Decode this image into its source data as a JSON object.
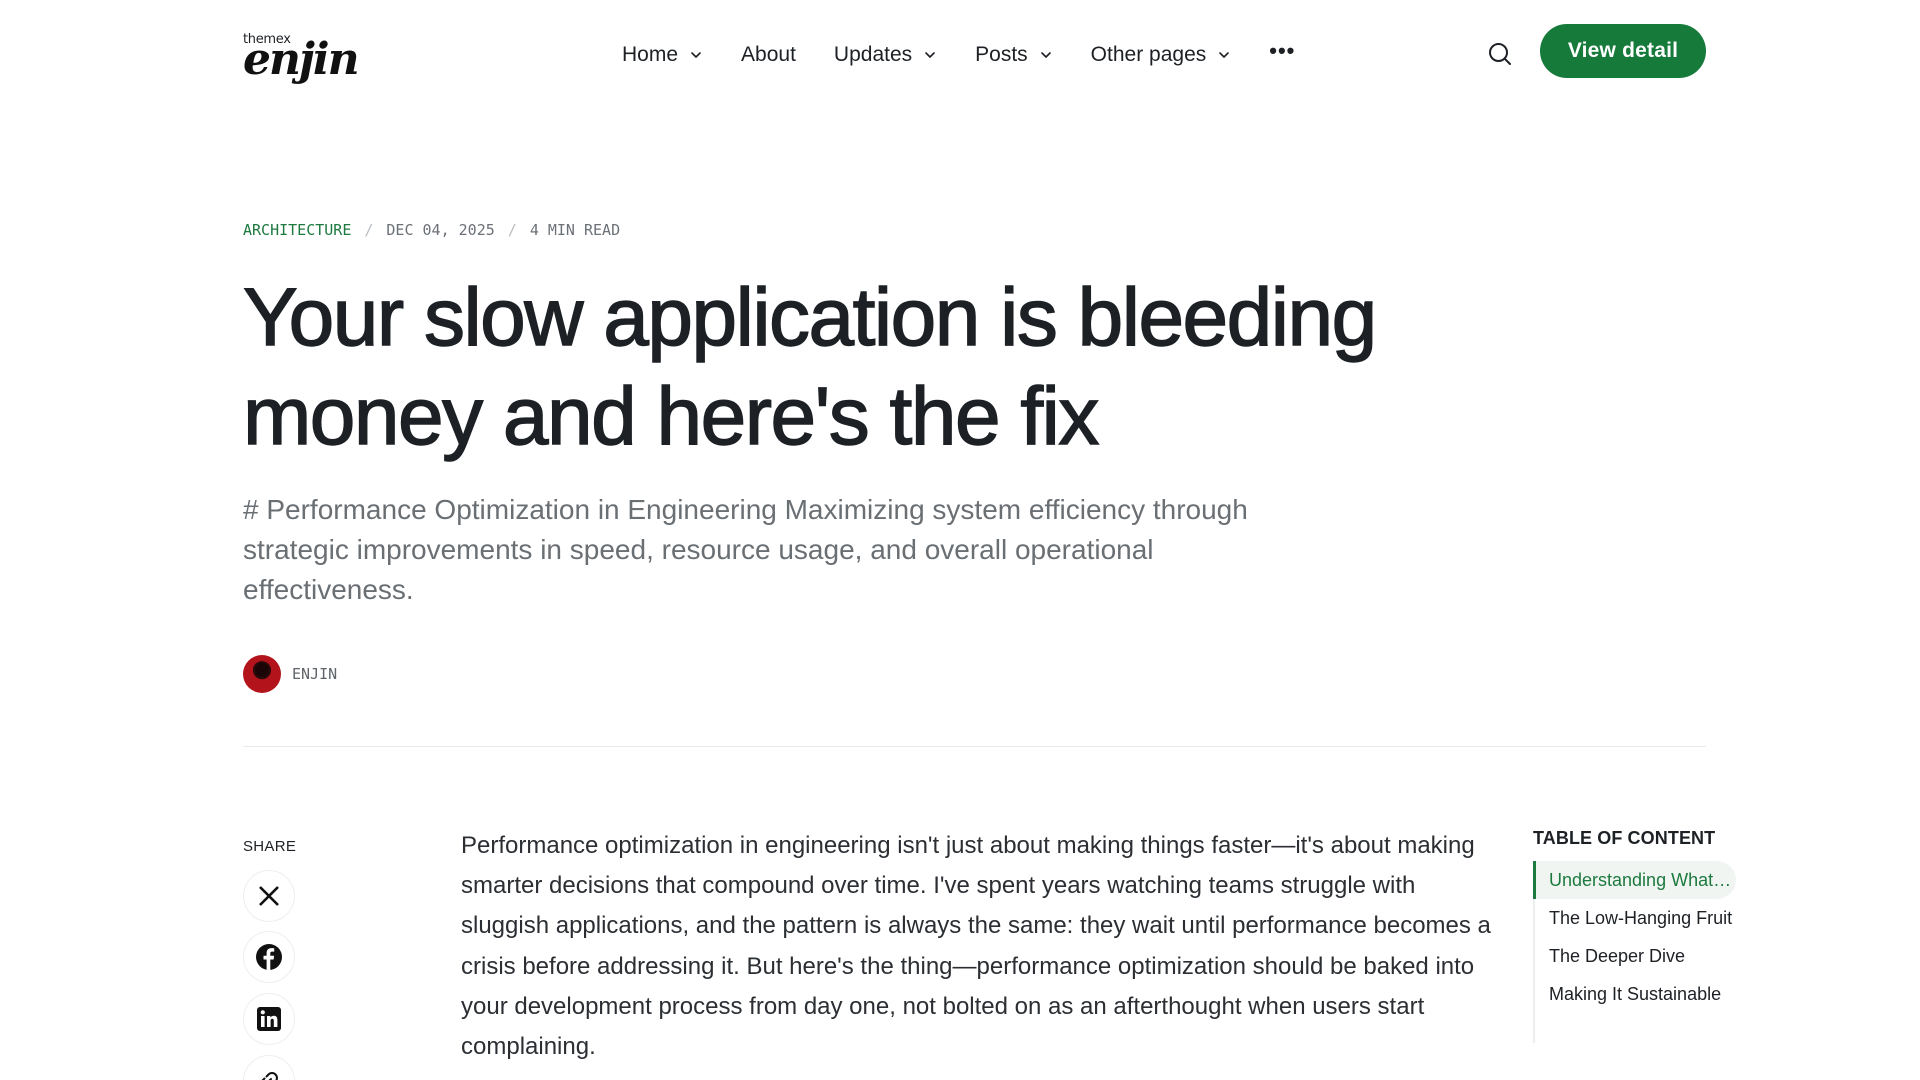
{
  "brand": {
    "logo_small": "themex",
    "logo_big": "enjin"
  },
  "nav": {
    "items": [
      {
        "label": "Home",
        "has_dropdown": true
      },
      {
        "label": "About",
        "has_dropdown": false
      },
      {
        "label": "Updates",
        "has_dropdown": true
      },
      {
        "label": "Posts",
        "has_dropdown": true
      },
      {
        "label": "Other pages",
        "has_dropdown": true
      }
    ],
    "more": "•••",
    "search_icon": "search-icon",
    "cta_label": "View detail"
  },
  "colors": {
    "accent": "#157a3a",
    "text": "#1d2125",
    "muted": "#6a6f74"
  },
  "article": {
    "category": "ARCHITECTURE",
    "date": "DEC 04, 2025",
    "read_time": "4 MIN READ",
    "title": "Your slow application is bleeding money and here's the fix",
    "subtitle": "# Performance Optimization in Engineering Maximizing system efficiency through strategic improvements in speed, resource usage, and overall operational effectiveness.",
    "author": "ENJIN",
    "body": "Performance optimization in engineering isn't just about making things faster—it's about making smarter decisions that compound over time. I've spent years watching teams struggle with sluggish applications, and the pattern is always the same: they wait until performance becomes a crisis before addressing it. But here's the thing—performance optimization should be baked into your development process from day one, not bolted on as an afterthought when users start complaining."
  },
  "share": {
    "label": "SHARE",
    "icons": [
      "x-icon",
      "facebook-icon",
      "linkedin-icon",
      "link-icon"
    ]
  },
  "toc": {
    "title": "TABLE OF CONTENT",
    "items": [
      {
        "label": "Understanding What Matters",
        "active": true
      },
      {
        "label": "The Low-Hanging Fruit",
        "active": false
      },
      {
        "label": "The Deeper Dive",
        "active": false
      },
      {
        "label": "Making It Sustainable",
        "active": false
      }
    ]
  }
}
